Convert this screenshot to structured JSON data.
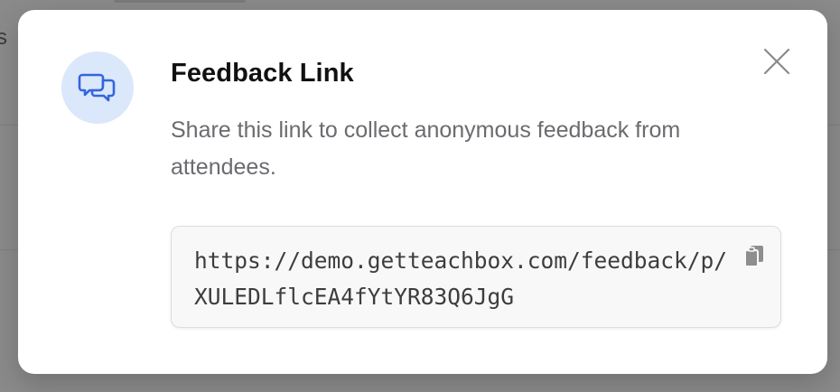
{
  "background": {
    "partial_letter": "s"
  },
  "modal": {
    "icon": "chat-bubbles-icon",
    "title": "Feedback Link",
    "description": "Share this link to collect anonymous feedback from attendees.",
    "link_url": "https://demo.getteachbox.com/feedback/p/XULEDLflcEA4fYtYR83Q6JgG",
    "close_icon": "close-icon",
    "copy_icon": "copy-icon"
  },
  "colors": {
    "overlay": "#8a8a8a",
    "icon_circle_bg": "#dbe7fb",
    "icon_stroke": "#3366dd",
    "title": "#111111",
    "description": "#6b6b70",
    "link_box_bg": "#f8f8f8"
  }
}
